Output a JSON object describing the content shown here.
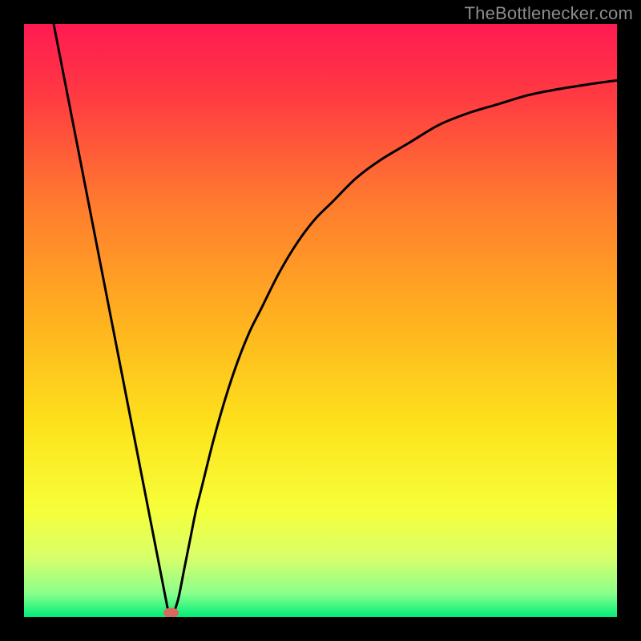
{
  "watermark": "TheBottlenecker.com",
  "chart_data": {
    "type": "line",
    "title": "",
    "xlabel": "",
    "ylabel": "",
    "xlim": [
      0,
      100
    ],
    "ylim": [
      0,
      100
    ],
    "axes_visible": false,
    "grid": false,
    "background_gradient": {
      "stops": [
        {
          "offset": 0.0,
          "color": "#FF1A52"
        },
        {
          "offset": 0.12,
          "color": "#FF3A42"
        },
        {
          "offset": 0.3,
          "color": "#FF7A2F"
        },
        {
          "offset": 0.5,
          "color": "#FFB21F"
        },
        {
          "offset": 0.68,
          "color": "#FDE31C"
        },
        {
          "offset": 0.82,
          "color": "#F6FF3A"
        },
        {
          "offset": 0.9,
          "color": "#D8FF6A"
        },
        {
          "offset": 0.96,
          "color": "#8BFF8B"
        },
        {
          "offset": 1.0,
          "color": "#00EE7A"
        }
      ]
    },
    "series": [
      {
        "name": "left-edge",
        "type": "segment",
        "x": [
          5,
          24.5
        ],
        "y": [
          100,
          0
        ]
      },
      {
        "name": "bottleneck-curve",
        "type": "curve",
        "x": [
          25,
          26,
          27,
          28,
          29,
          30,
          32,
          34,
          36,
          38,
          40,
          43,
          46,
          49,
          52,
          56,
          60,
          65,
          70,
          75,
          80,
          85,
          90,
          95,
          100
        ],
        "y": [
          0,
          3,
          8,
          13,
          18,
          22,
          30,
          37,
          43,
          48,
          52,
          58,
          63,
          67,
          70,
          74,
          77,
          80,
          83,
          85,
          86.5,
          88,
          89,
          89.8,
          90.5
        ]
      }
    ],
    "marker": {
      "name": "optimal-point",
      "x": 24.8,
      "y": 0.7,
      "rx": 1.3,
      "ry": 0.85,
      "fill": "#D66A5C"
    }
  }
}
